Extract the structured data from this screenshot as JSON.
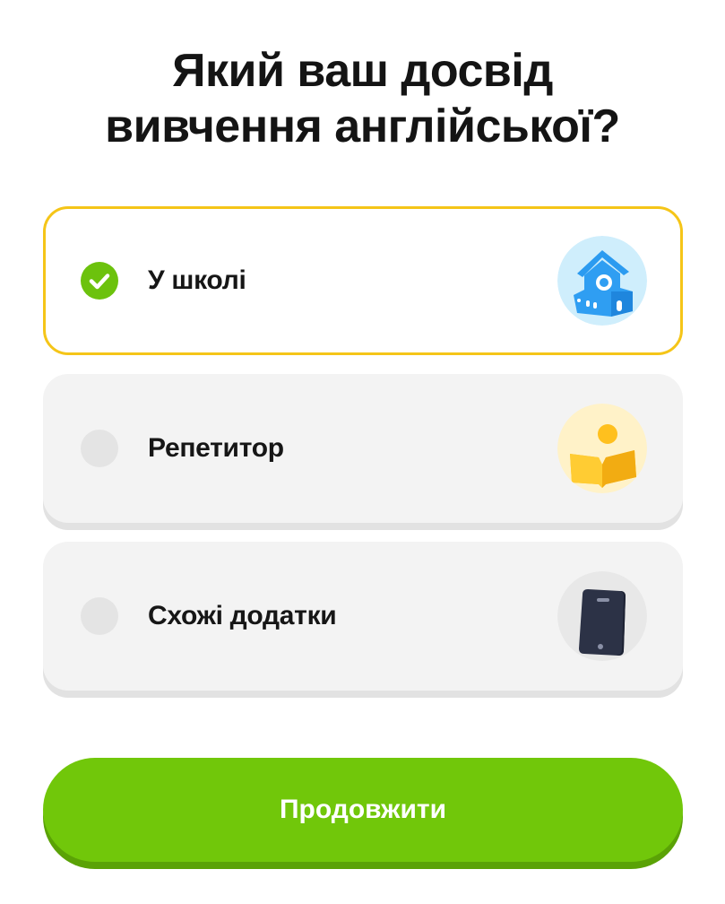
{
  "question": {
    "line1": "Який ваш досвід",
    "line2": "вивчення англійської?"
  },
  "options": [
    {
      "label": "У школі",
      "selected": true,
      "icon": "school-building-icon"
    },
    {
      "label": "Репетитор",
      "selected": false,
      "icon": "tutor-reading-icon"
    },
    {
      "label": "Схожі додатки",
      "selected": false,
      "icon": "smartphone-icon"
    }
  ],
  "continue_label": "Продовжити",
  "colors": {
    "accent_green": "#71c70a",
    "selected_border": "#f5c518",
    "check_green": "#6cc20d",
    "option_bg": "#f3f3f3"
  }
}
